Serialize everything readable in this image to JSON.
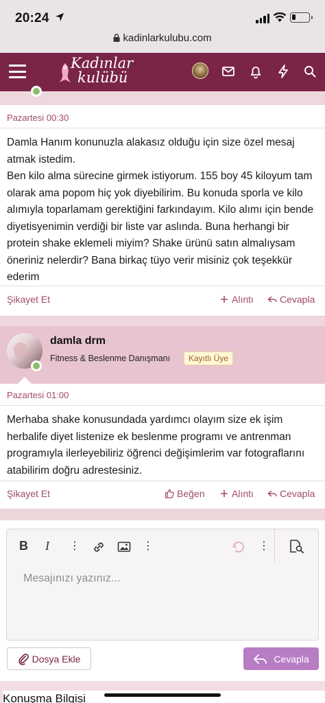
{
  "status_bar": {
    "time": "20:24"
  },
  "browser": {
    "url": "kadinlarkulubu.com"
  },
  "site": {
    "logo_line1": "Kadınlar",
    "logo_line2": "kulübü"
  },
  "posts": [
    {
      "date": "Pazartesi 00:30",
      "body": "Damla Hanım konunuzla alakasız olduğu için size özel mesaj atmak istedim.\nBen kilo alma sürecine girmek istiyorum. 155 boy 45 kiloyum tam olarak ama popom hiç yok diyebilirim. Bu konuda sporla ve kilo alımıyla toparlamam gerektiğini farkındayım. Kilo alımı için bende diyetisyenimin verdiği bir liste var aslında. Buna herhangi bir protein shake eklemeli miyim? Shake ürünü satın almalıysam öneriniz nelerdir? Bana birkaç tüyo verir misiniz çok teşekkür ederim",
      "report": "Şikayet Et",
      "quote": "Alıntı",
      "reply": "Cevapla"
    },
    {
      "username": "damla drm",
      "user_title": "Fitness & Beslenme Danışmanı",
      "user_badge": "Kayıtlı Üye",
      "date": "Pazartesi 01:00",
      "body": "Merhaba shake konusundada yardımcı olayım size ek işim herbalife diyet listenize ek beslenme programı ve antrenman programıyla ilerleyebiliriz öğrenci değişimlerim var fotograflarını atabilirim doğru adrestesiniz.",
      "report": "Şikayet Et",
      "like": "Beğen",
      "quote": "Alıntı",
      "reply": "Cevapla"
    }
  ],
  "editor": {
    "placeholder": "Mesajınızı yazınız...",
    "attach_label": "Dosya Ekle",
    "reply_label": "Cevapla"
  },
  "section": {
    "title": "Konuşma Bilgisi"
  },
  "colors": {
    "header": "#7a2447",
    "accent": "#a24a69",
    "reply_button": "#b77cc4",
    "online": "#8cbc6a"
  }
}
